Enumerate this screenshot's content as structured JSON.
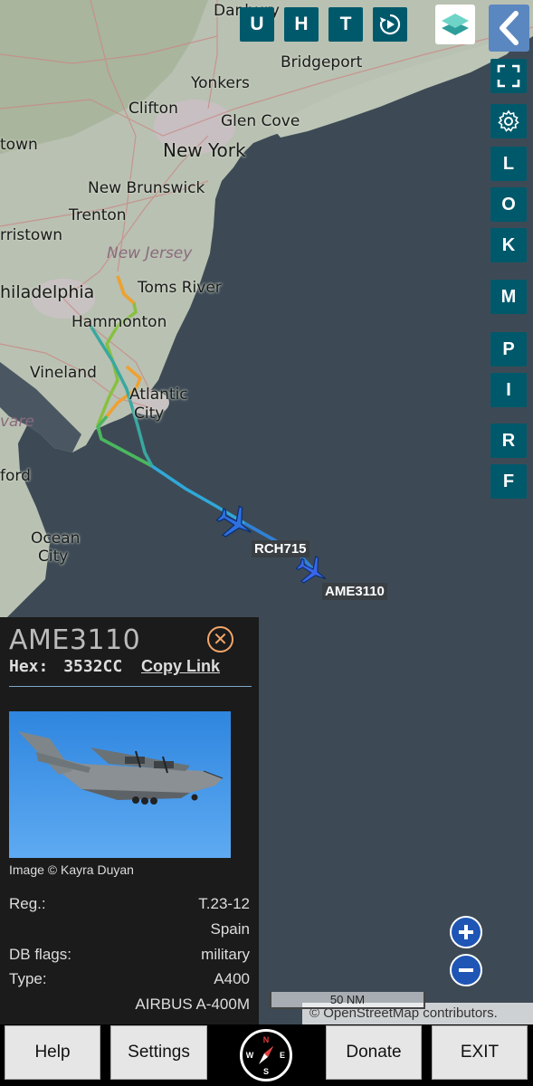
{
  "toolbar": {
    "buttons": [
      "U",
      "H",
      "T"
    ],
    "replay_icon": "replay-icon",
    "layers_icon": "layers-icon",
    "back_icon": "chevron-left-icon"
  },
  "side_buttons": [
    "L",
    "O",
    "K",
    "M",
    "P",
    "I",
    "R",
    "F"
  ],
  "side_icons": [
    "fullscreen-icon",
    "gear-icon"
  ],
  "map": {
    "places": [
      "Danbury",
      "Bridgeport",
      "Yonkers",
      "Clifton",
      "Glen Cove",
      "New York",
      "town",
      "New Brunswick",
      "Trenton",
      "rristown",
      "New Jersey",
      "Toms River",
      "hiladelphia",
      "Hammonton",
      "Vineland",
      "Atlantic",
      "City",
      "vare",
      "ford",
      "Ocean",
      "City"
    ],
    "aircraft": [
      {
        "callsign": "RCH715"
      },
      {
        "callsign": "AME3110"
      }
    ]
  },
  "info": {
    "callsign": "AME3110",
    "hex_label": "Hex:",
    "hex_value": "3532CC",
    "copy_link": "Copy Link",
    "image_credit": "Image © Kayra Duyan",
    "rows": [
      {
        "key": "Reg.:",
        "value": "T.23-12"
      },
      {
        "key": "",
        "value": "Spain"
      },
      {
        "key": "DB flags:",
        "value": "military"
      },
      {
        "key": "Type:",
        "value": "A400"
      },
      {
        "key": "",
        "value": "AIRBUS A-400M"
      }
    ]
  },
  "scale": "50 NM",
  "attribution": "© OpenStreetMap contributors.",
  "bottom": {
    "help": "Help",
    "settings": "Settings",
    "donate": "Donate",
    "exit": "EXIT",
    "compass": {
      "n": "N",
      "e": "E",
      "s": "S",
      "w": "W"
    }
  },
  "colors": {
    "button_teal": "#00596b",
    "back_blue": "#5b87c0",
    "ocean": "#3d4a55",
    "land": "#b8c0b0",
    "plane_blue": "#2f6fe0",
    "close_orange": "#f2a66a"
  }
}
